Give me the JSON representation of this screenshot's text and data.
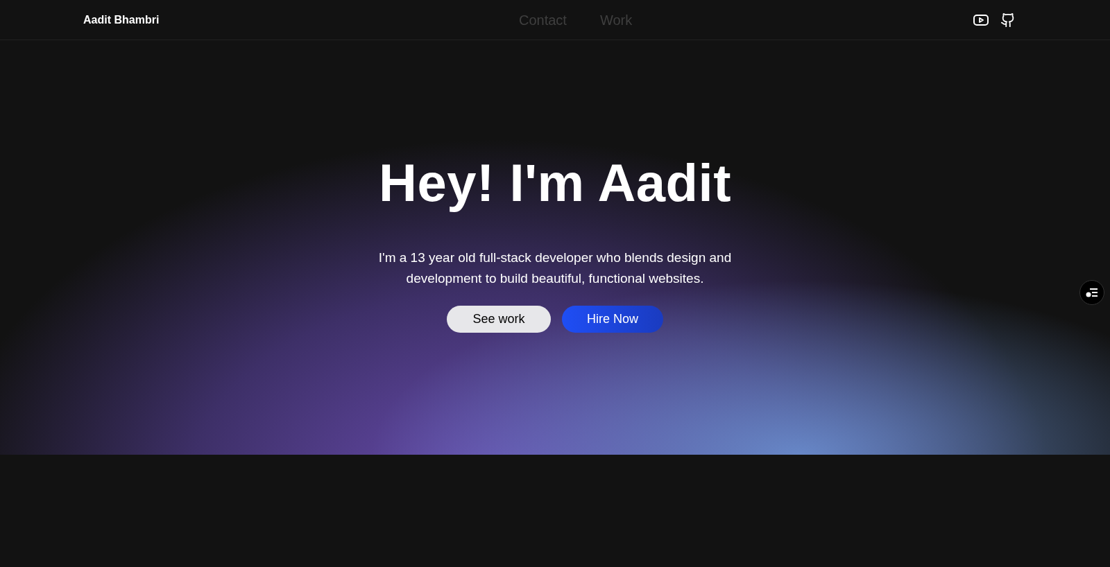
{
  "header": {
    "brand": "Aadit Bhambri",
    "nav_links": [
      {
        "label": "Contact"
      },
      {
        "label": "Work"
      }
    ]
  },
  "hero": {
    "title": "Hey! I'm Aadit",
    "subtitle": "I'm a 13 year old full-stack developer who blends design and development to build beautiful, functional websites.",
    "buttons": [
      {
        "label": "See work",
        "kind": "secondary"
      },
      {
        "label": "Hire Now",
        "kind": "primary"
      }
    ]
  }
}
